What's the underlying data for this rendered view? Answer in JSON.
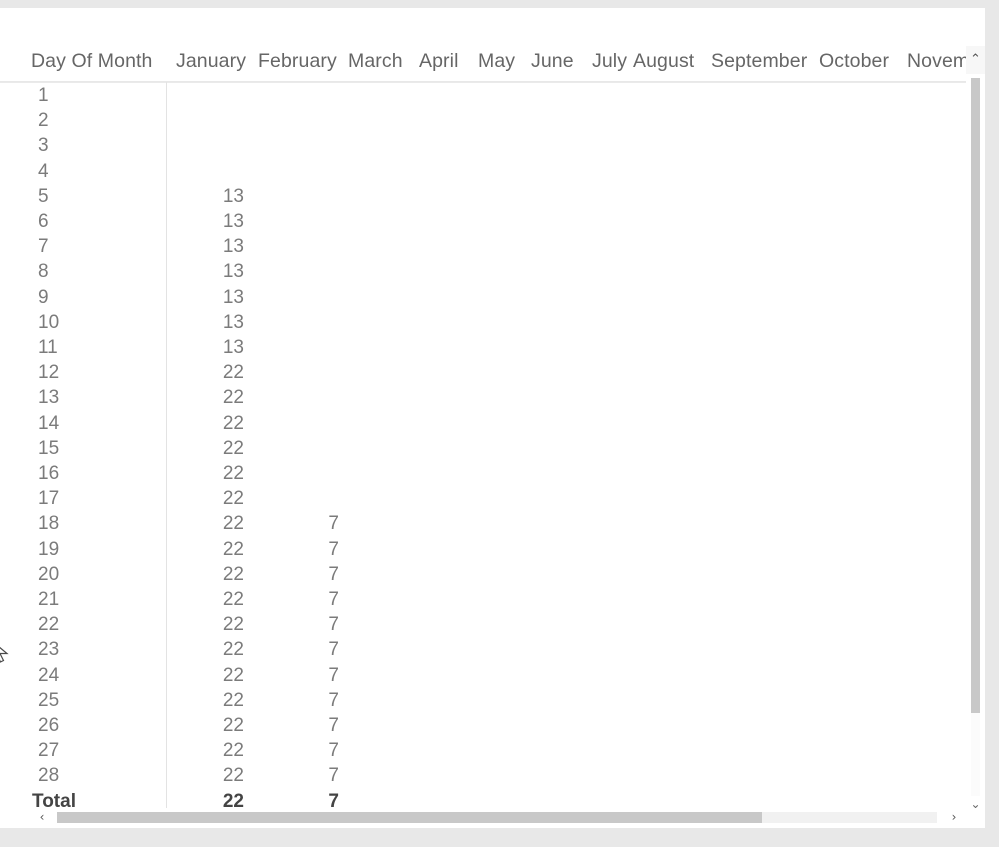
{
  "table": {
    "row_header_label": "Day Of Month",
    "columns": [
      "January",
      "February",
      "March",
      "April",
      "May",
      "June",
      "July",
      "August",
      "September",
      "October",
      "Novem"
    ],
    "column_last_truncated": true,
    "total_label": "Total",
    "rows": [
      {
        "day": "1",
        "January": "",
        "February": ""
      },
      {
        "day": "2",
        "January": "",
        "February": ""
      },
      {
        "day": "3",
        "January": "",
        "February": ""
      },
      {
        "day": "4",
        "January": "",
        "February": ""
      },
      {
        "day": "5",
        "January": "13",
        "February": ""
      },
      {
        "day": "6",
        "January": "13",
        "February": ""
      },
      {
        "day": "7",
        "January": "13",
        "February": ""
      },
      {
        "day": "8",
        "January": "13",
        "February": ""
      },
      {
        "day": "9",
        "January": "13",
        "February": ""
      },
      {
        "day": "10",
        "January": "13",
        "February": ""
      },
      {
        "day": "11",
        "January": "13",
        "February": ""
      },
      {
        "day": "12",
        "January": "22",
        "February": ""
      },
      {
        "day": "13",
        "January": "22",
        "February": ""
      },
      {
        "day": "14",
        "January": "22",
        "February": ""
      },
      {
        "day": "15",
        "January": "22",
        "February": ""
      },
      {
        "day": "16",
        "January": "22",
        "February": ""
      },
      {
        "day": "17",
        "January": "22",
        "February": ""
      },
      {
        "day": "18",
        "January": "22",
        "February": "7"
      },
      {
        "day": "19",
        "January": "22",
        "February": "7"
      },
      {
        "day": "20",
        "January": "22",
        "February": "7"
      },
      {
        "day": "21",
        "January": "22",
        "February": "7"
      },
      {
        "day": "22",
        "January": "22",
        "February": "7"
      },
      {
        "day": "23",
        "January": "22",
        "February": "7"
      },
      {
        "day": "24",
        "January": "22",
        "February": "7"
      },
      {
        "day": "25",
        "January": "22",
        "February": "7"
      },
      {
        "day": "26",
        "January": "22",
        "February": "7"
      },
      {
        "day": "27",
        "January": "22",
        "February": "7"
      },
      {
        "day": "28",
        "January": "22",
        "February": "7"
      }
    ],
    "total_row": {
      "day": "Total",
      "January": "22",
      "February": "7"
    }
  },
  "scrollbars": {
    "vertical": {
      "up_arrow": "⌃",
      "down_arrow": "⌄"
    },
    "horizontal": {
      "left_arrow": "‹",
      "right_arrow": "›"
    }
  },
  "colors": {
    "text": "#7b7b7b",
    "header_text": "#666666",
    "total_text": "#444444",
    "scroll_thumb": "#c8c8c8",
    "background": "#e8e8e8",
    "card": "#ffffff"
  }
}
